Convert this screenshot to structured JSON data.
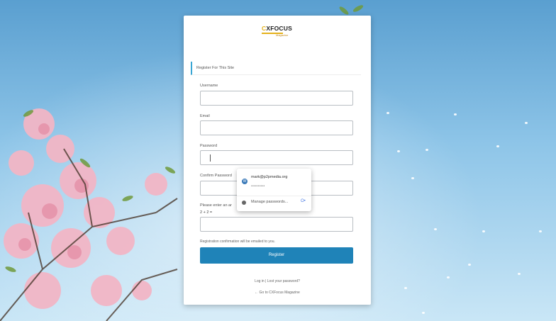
{
  "site": {
    "logo_main_c": "C",
    "logo_main_rest": "XFOCUS",
    "logo_sub": "Magazine"
  },
  "form": {
    "section_title": "Register For This Site",
    "username_label": "Username",
    "email_label": "Email",
    "password_label": "Password",
    "confirm_label": "Confirm Password",
    "math_prompt": "Please enter an ar",
    "math_question": "2 + 2 =",
    "note": "Registration confirmation will be emailed to you.",
    "submit_label": "Register",
    "login_links": "Log in | Lost your password?",
    "back_link": "← Go to CXFocus Magazine"
  },
  "autofill": {
    "account": "mark@p2pmedia.org",
    "masked_password": "••••••••••",
    "manage_label": "Manage passwords...",
    "manage_icon": "key-icon"
  },
  "colors": {
    "accent": "#1f83b8",
    "brand": "#e4b11a"
  }
}
